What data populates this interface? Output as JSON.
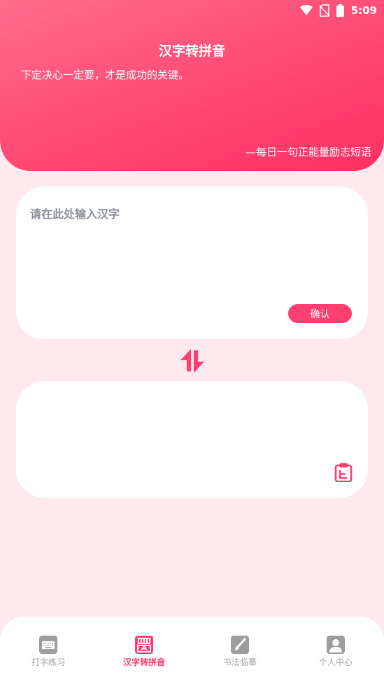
{
  "status_bar": {
    "time": "5:09"
  },
  "header": {
    "title": "汉字转拼音",
    "quote": "下定决心一定要，才是成功的关键。",
    "quote_source": "—每日一句正能量励志短语"
  },
  "input_card": {
    "placeholder": "请在此处输入汉字",
    "value": "",
    "confirm_label": "确认"
  },
  "output_card": {
    "value": ""
  },
  "bottom_nav": {
    "items": [
      {
        "label": "打字练习",
        "icon": "keyboard-icon",
        "active": false
      },
      {
        "label": "汉字转拼音",
        "icon": "pinyin-icon",
        "active": true
      },
      {
        "label": "书法临摹",
        "icon": "brush-icon",
        "active": false
      },
      {
        "label": "个人中心",
        "icon": "user-icon",
        "active": false
      }
    ]
  },
  "colors": {
    "accent": "#ff3f6f",
    "header_gradient_start": "#ff6d8d",
    "header_gradient_end": "#ff2f63",
    "background": "#ffe9ee",
    "inactive": "#a3a3a3"
  }
}
